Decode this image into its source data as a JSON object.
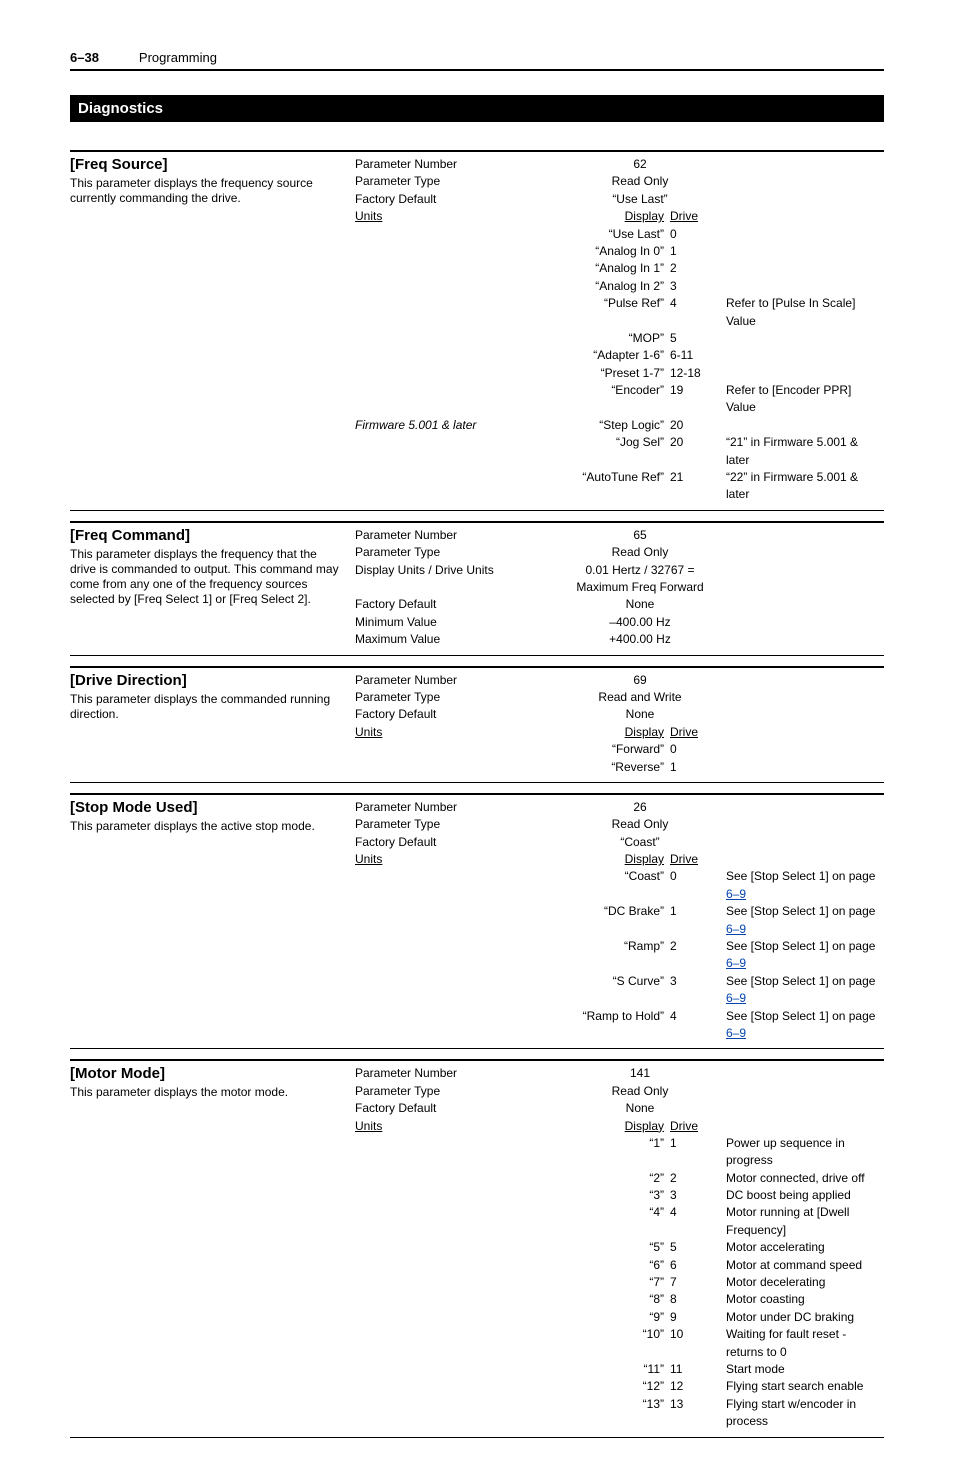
{
  "header": {
    "page_number": "6–38",
    "chapter": "Programming"
  },
  "section": {
    "title": "Diagnostics"
  },
  "params": [
    {
      "name": "[Freq Source]",
      "desc": "This parameter displays the frequency source currently commanding the drive.",
      "kv": [
        {
          "key": "Parameter Number",
          "val": "62"
        },
        {
          "key": "Parameter Type",
          "val": "Read Only"
        },
        {
          "key": "Factory Default",
          "val": "“Use Last”"
        }
      ],
      "units_hdr": {
        "key": "Units",
        "display": "Display",
        "drive": "Drive"
      },
      "units_rows": [
        {
          "disp": "“Use Last”",
          "drv": "0",
          "note": ""
        },
        {
          "disp": "“Analog In 0”",
          "drv": "1",
          "note": ""
        },
        {
          "disp": "“Analog In 1”",
          "drv": "2",
          "note": ""
        },
        {
          "disp": "“Analog In 2”",
          "drv": "3",
          "note": ""
        },
        {
          "disp": "“Pulse Ref”",
          "drv": "4",
          "note": "Refer to [Pulse In Scale] Value"
        },
        {
          "disp": "“MOP”",
          "drv": "5",
          "note": ""
        },
        {
          "disp": "“Adapter 1-6”",
          "drv": "6-11",
          "note": ""
        },
        {
          "disp": "“Preset 1-7”",
          "drv": "12-18",
          "note": ""
        },
        {
          "disp": "“Encoder”",
          "drv": "19",
          "note": "Refer to [Encoder PPR] Value"
        },
        {
          "disp": "“Step Logic”",
          "drv": "20",
          "note": "",
          "key_left": "Firmware 5.001 & later",
          "key_italic": true
        },
        {
          "disp": "“Jog Sel”",
          "drv": "20",
          "note": "“21” in Firmware 5.001 & later",
          "note_italic": true
        },
        {
          "disp": "“AutoTune Ref”",
          "drv": "21",
          "note": "“22” in Firmware 5.001 & later",
          "note_italic": true
        }
      ]
    },
    {
      "name": "[Freq Command]",
      "desc": "This parameter displays the frequency that the drive is commanded to output. This command may come from any one of the frequency sources selected by [Freq Select 1] or [Freq Select 2].",
      "kv": [
        {
          "key": "Parameter Number",
          "val": "65"
        },
        {
          "key": "Parameter Type",
          "val": "Read Only"
        },
        {
          "key": "Display Units / Drive Units",
          "val": "0.01 Hertz / 32767 = Maximum Freq Forward"
        },
        {
          "key": "Factory Default",
          "val": "None"
        },
        {
          "key": "Minimum Value",
          "val": "–400.00 Hz"
        },
        {
          "key": "Maximum Value",
          "val": "+400.00 Hz"
        }
      ]
    },
    {
      "name": "[Drive Direction]",
      "desc": "This parameter displays the commanded running direction.",
      "kv": [
        {
          "key": "Parameter Number",
          "val": "69"
        },
        {
          "key": "Parameter Type",
          "val": "Read and Write"
        },
        {
          "key": "Factory Default",
          "val": "None"
        }
      ],
      "units_hdr": {
        "key": "Units",
        "display": "Display",
        "drive": "Drive"
      },
      "units_rows": [
        {
          "disp": "“Forward”",
          "drv": "0",
          "note": ""
        },
        {
          "disp": "“Reverse”",
          "drv": "1",
          "note": ""
        }
      ]
    },
    {
      "name": "[Stop Mode Used]",
      "desc": "This parameter displays the active stop mode.",
      "kv": [
        {
          "key": "Parameter Number",
          "val": "26"
        },
        {
          "key": "Parameter Type",
          "val": "Read Only"
        },
        {
          "key": "Factory Default",
          "val": "“Coast”"
        }
      ],
      "units_hdr": {
        "key": "Units",
        "display": "Display",
        "drive": "Drive"
      },
      "units_rows": [
        {
          "disp": "“Coast”",
          "drv": "0",
          "note_prefix": "See [Stop Select 1] on page ",
          "link": "6–9"
        },
        {
          "disp": "“DC Brake”",
          "drv": "1",
          "note_prefix": "See [Stop Select 1] on page ",
          "link": "6–9"
        },
        {
          "disp": "“Ramp”",
          "drv": "2",
          "note_prefix": "See [Stop Select 1] on page ",
          "link": "6–9"
        },
        {
          "disp": "“S Curve”",
          "drv": "3",
          "note_prefix": "See [Stop Select 1] on page ",
          "link": "6–9"
        },
        {
          "disp": "“Ramp to Hold”",
          "drv": "4",
          "note_prefix": "See [Stop Select 1] on page ",
          "link": "6–9"
        }
      ]
    },
    {
      "name": "[Motor Mode]",
      "desc": "This parameter displays the motor mode.",
      "kv": [
        {
          "key": "Parameter Number",
          "val": "141"
        },
        {
          "key": "Parameter Type",
          "val": "Read Only"
        },
        {
          "key": "Factory Default",
          "val": "None"
        }
      ],
      "units_hdr": {
        "key": "Units",
        "display": "Display",
        "drive": "Drive"
      },
      "units_rows": [
        {
          "disp": "“1”",
          "drv": "1",
          "note": "Power up sequence in progress"
        },
        {
          "disp": "“2”",
          "drv": "2",
          "note": "Motor connected, drive off"
        },
        {
          "disp": "“3”",
          "drv": "3",
          "note": "DC boost being applied"
        },
        {
          "disp": "“4”",
          "drv": "4",
          "note": "Motor running at [Dwell Frequency]"
        },
        {
          "disp": "“5”",
          "drv": "5",
          "note": "Motor accelerating"
        },
        {
          "disp": "“6”",
          "drv": "6",
          "note": "Motor at command speed"
        },
        {
          "disp": "“7”",
          "drv": "7",
          "note": "Motor decelerating"
        },
        {
          "disp": "“8”",
          "drv": "8",
          "note": "Motor coasting"
        },
        {
          "disp": "“9”",
          "drv": "9",
          "note": "Motor under DC braking"
        },
        {
          "disp": "“10”",
          "drv": "10",
          "note": "Waiting for fault reset - returns to 0"
        },
        {
          "disp": "“11”",
          "drv": "11",
          "note": "Start mode"
        },
        {
          "disp": "“12”",
          "drv": "12",
          "note": "Flying start search enable"
        },
        {
          "disp": "“13”",
          "drv": "13",
          "note": "Flying start w/encoder in process"
        }
      ]
    }
  ]
}
